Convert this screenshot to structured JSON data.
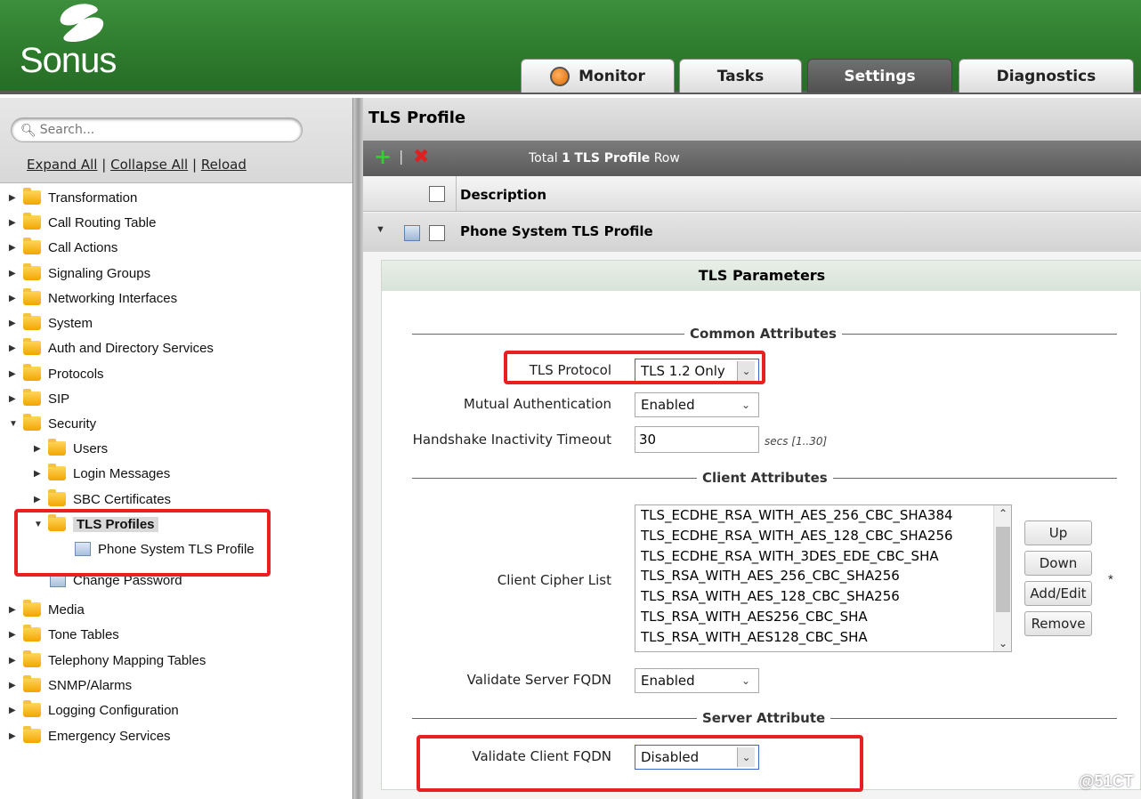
{
  "brand": {
    "name": "Sonus"
  },
  "tabs": [
    {
      "label": "Monitor",
      "active": false
    },
    {
      "label": "Tasks",
      "active": false
    },
    {
      "label": "Settings",
      "active": true
    },
    {
      "label": "Diagnostics",
      "active": false
    }
  ],
  "sidebar": {
    "search_placeholder": "Search...",
    "links": {
      "expand": "Expand All",
      "collapse": "Collapse All",
      "reload": "Reload",
      "sep": "|"
    },
    "tree": [
      {
        "label": "Transformation"
      },
      {
        "label": "Call Routing Table"
      },
      {
        "label": "Call Actions"
      },
      {
        "label": "Signaling Groups"
      },
      {
        "label": "Networking Interfaces"
      },
      {
        "label": "System"
      },
      {
        "label": "Auth and Directory Services"
      },
      {
        "label": "Protocols"
      },
      {
        "label": "SIP"
      },
      {
        "label": "Security",
        "expanded": true
      },
      {
        "label": "Users"
      },
      {
        "label": "Login Messages"
      },
      {
        "label": "SBC Certificates"
      },
      {
        "label": "TLS Profiles",
        "expanded": true,
        "selected": true
      },
      {
        "label": "Phone System TLS Profile"
      },
      {
        "label": "Change Password"
      },
      {
        "label": "Media"
      },
      {
        "label": "Tone Tables"
      },
      {
        "label": "Telephony Mapping Tables"
      },
      {
        "label": "SNMP/Alarms"
      },
      {
        "label": "Logging Configuration"
      },
      {
        "label": "Emergency Services"
      }
    ]
  },
  "main": {
    "title": "TLS Profile",
    "toolbar": {
      "total_prefix": "Total",
      "total_count": "1",
      "total_entity": "TLS Profile",
      "total_suffix": "Row"
    },
    "column_header": "Description",
    "row_label": "Phone System TLS Profile",
    "panel": {
      "title": "TLS Parameters",
      "sections": {
        "common": "Common Attributes",
        "client": "Client Attributes",
        "server": "Server Attribute"
      },
      "fields": {
        "tls_protocol": {
          "label": "TLS Protocol",
          "value": "TLS 1.2 Only"
        },
        "mutual_auth": {
          "label": "Mutual Authentication",
          "value": "Enabled"
        },
        "handshake_timeout": {
          "label": "Handshake Inactivity Timeout",
          "value": "30",
          "hint": "secs [1..30]"
        },
        "cipher_list": {
          "label": "Client Cipher List",
          "items": [
            "TLS_ECDHE_RSA_WITH_AES_256_CBC_SHA384",
            "TLS_ECDHE_RSA_WITH_AES_128_CBC_SHA256",
            "TLS_ECDHE_RSA_WITH_3DES_EDE_CBC_SHA",
            "TLS_RSA_WITH_AES_256_CBC_SHA256",
            "TLS_RSA_WITH_AES_128_CBC_SHA256",
            "TLS_RSA_WITH_AES256_CBC_SHA",
            "TLS_RSA_WITH_AES128_CBC_SHA"
          ]
        },
        "validate_server": {
          "label": "Validate Server FQDN",
          "value": "Enabled"
        },
        "validate_client": {
          "label": "Validate Client FQDN",
          "value": "Disabled"
        }
      },
      "buttons": {
        "up": "Up",
        "down": "Down",
        "add_edit": "Add/Edit",
        "remove": "Remove"
      },
      "required_mark": "*"
    }
  },
  "watermark": "@51CT",
  "colors": {
    "header_green": "#2d7a2d",
    "highlight_red": "#e82020",
    "add_green": "#2fd12f",
    "delete_red": "#e02020"
  }
}
